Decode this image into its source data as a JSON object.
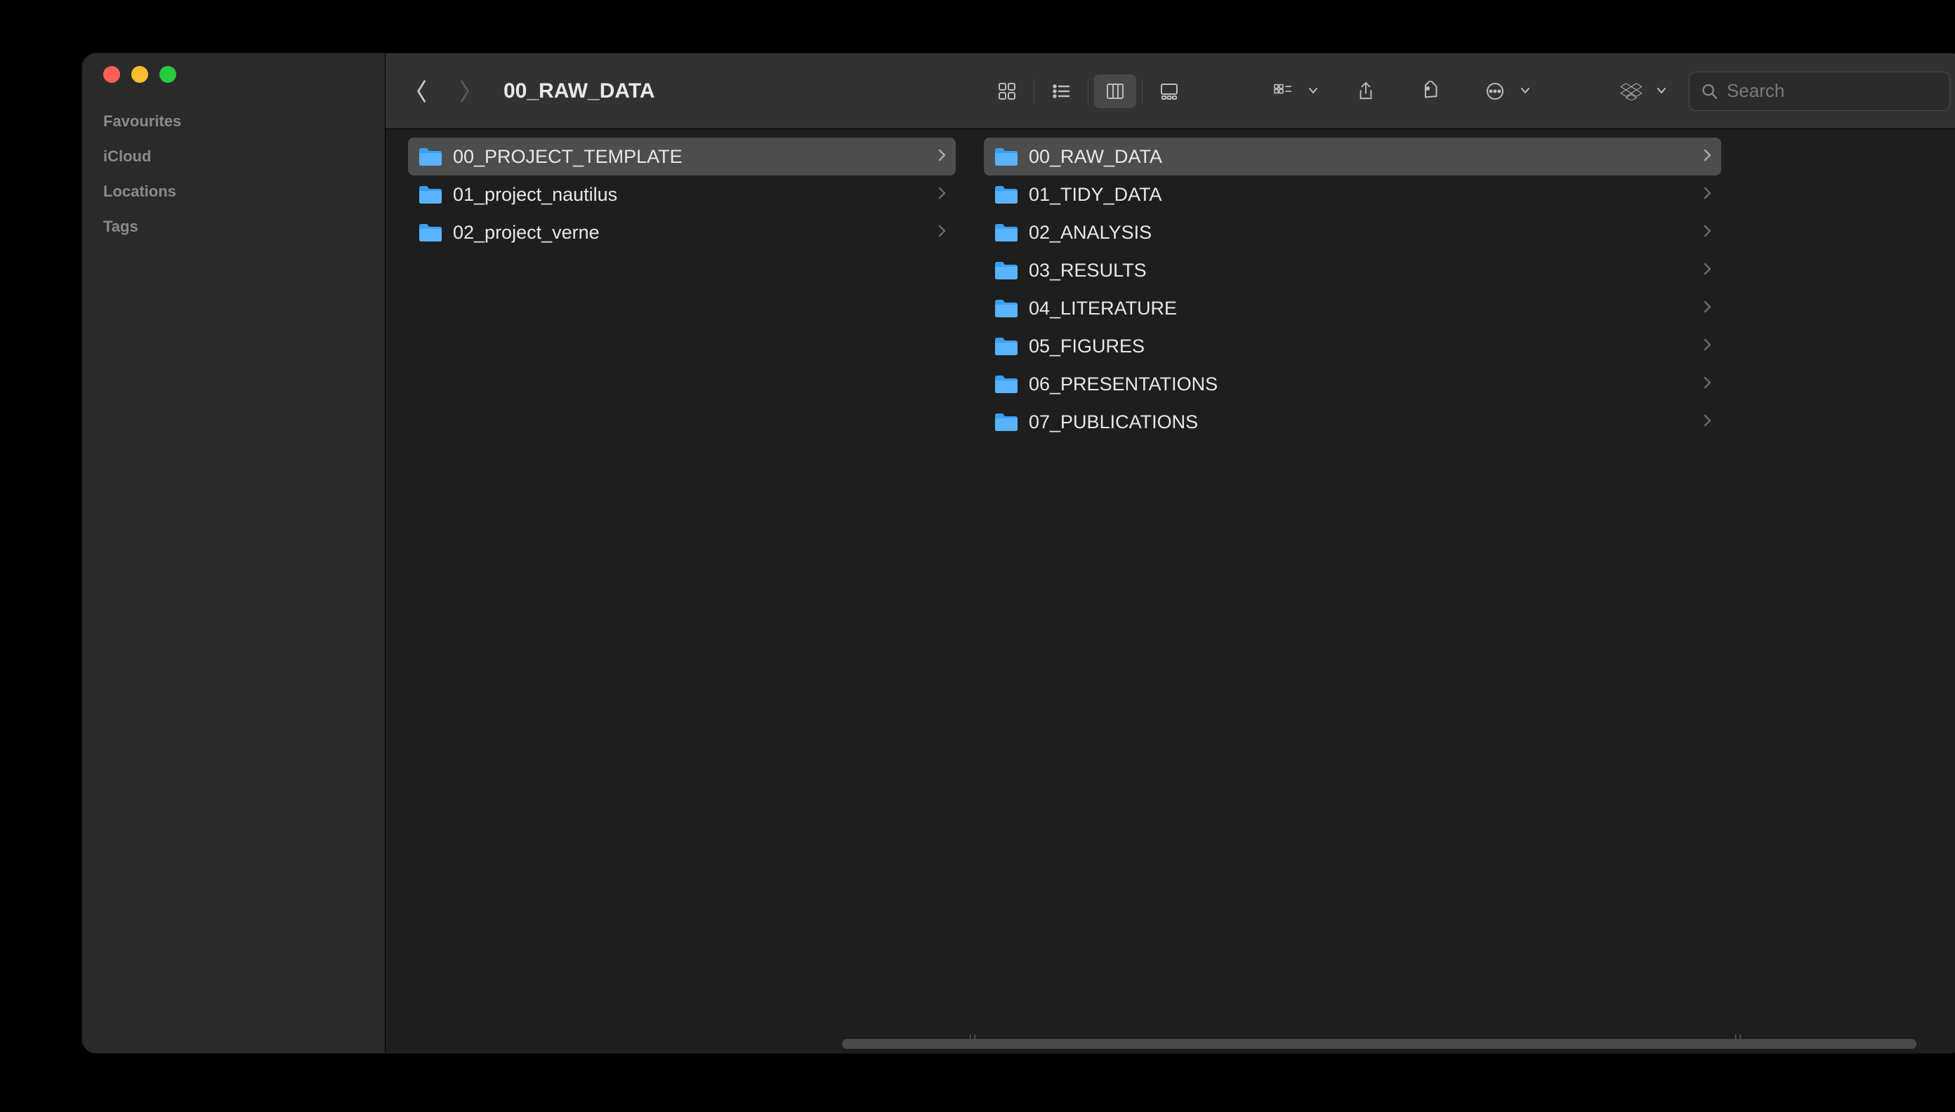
{
  "window": {
    "title": "00_RAW_DATA"
  },
  "sidebar": {
    "sections": [
      "Favourites",
      "iCloud",
      "Locations",
      "Tags"
    ]
  },
  "search": {
    "placeholder": "Search"
  },
  "columns": [
    {
      "items": [
        {
          "name": "00_PROJECT_TEMPLATE",
          "selected": true
        },
        {
          "name": "01_project_nautilus",
          "selected": false
        },
        {
          "name": "02_project_verne",
          "selected": false
        }
      ]
    },
    {
      "items": [
        {
          "name": "00_RAW_DATA",
          "selected": true
        },
        {
          "name": "01_TIDY_DATA",
          "selected": false
        },
        {
          "name": "02_ANALYSIS",
          "selected": false
        },
        {
          "name": "03_RESULTS",
          "selected": false
        },
        {
          "name": "04_LITERATURE",
          "selected": false
        },
        {
          "name": "05_FIGURES",
          "selected": false
        },
        {
          "name": "06_PRESENTATIONS",
          "selected": false
        },
        {
          "name": "07_PUBLICATIONS",
          "selected": false
        }
      ]
    }
  ]
}
